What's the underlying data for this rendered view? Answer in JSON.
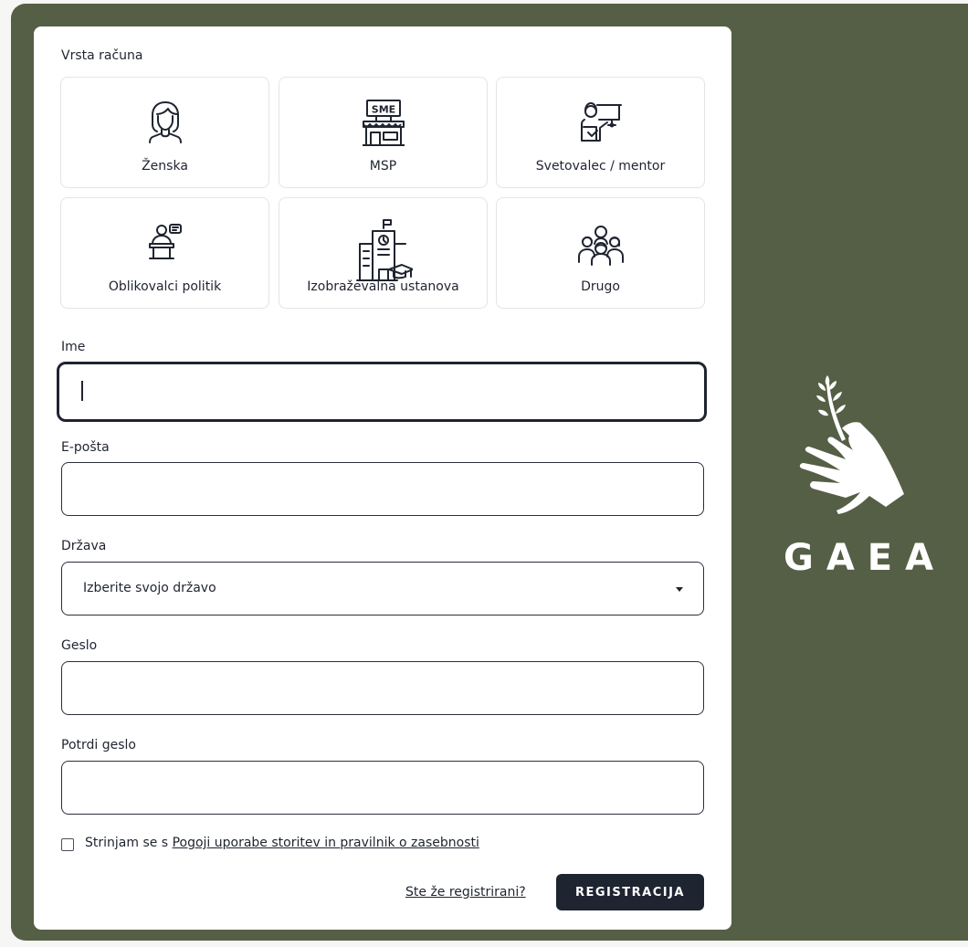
{
  "form": {
    "account_type_label": "Vrsta računa",
    "account_types": [
      {
        "label": "Ženska",
        "icon": "woman-icon"
      },
      {
        "label": "MSP",
        "icon": "sme-shop-icon",
        "icon_text": "SME"
      },
      {
        "label": "Svetovalec / mentor",
        "icon": "mentor-presentation-icon"
      },
      {
        "label": "Oblikovalci politik",
        "icon": "policy-maker-podium-icon"
      },
      {
        "label": "Izobraževalna ustanova",
        "icon": "school-building-icon"
      },
      {
        "label": "Drugo",
        "icon": "group-people-icon"
      }
    ],
    "name_label": "Ime",
    "name_value": "",
    "email_label": "E-pošta",
    "email_value": "",
    "country_label": "Država",
    "country_selected": "Izberite svojo državo",
    "password_label": "Geslo",
    "password_value": "",
    "confirm_label": "Potrdi geslo",
    "confirm_value": "",
    "agree_prefix": "Strinjam se s ",
    "agree_link": "Pogoji uporabe storitev in pravilnik o zasebnosti",
    "login_link": "Ste že registrirani?",
    "submit_label": "REGISTRACIJA"
  },
  "brand": {
    "name": "GAEA",
    "logo_icon": "hand-holding-plant-icon",
    "background_color": "#555f45"
  }
}
